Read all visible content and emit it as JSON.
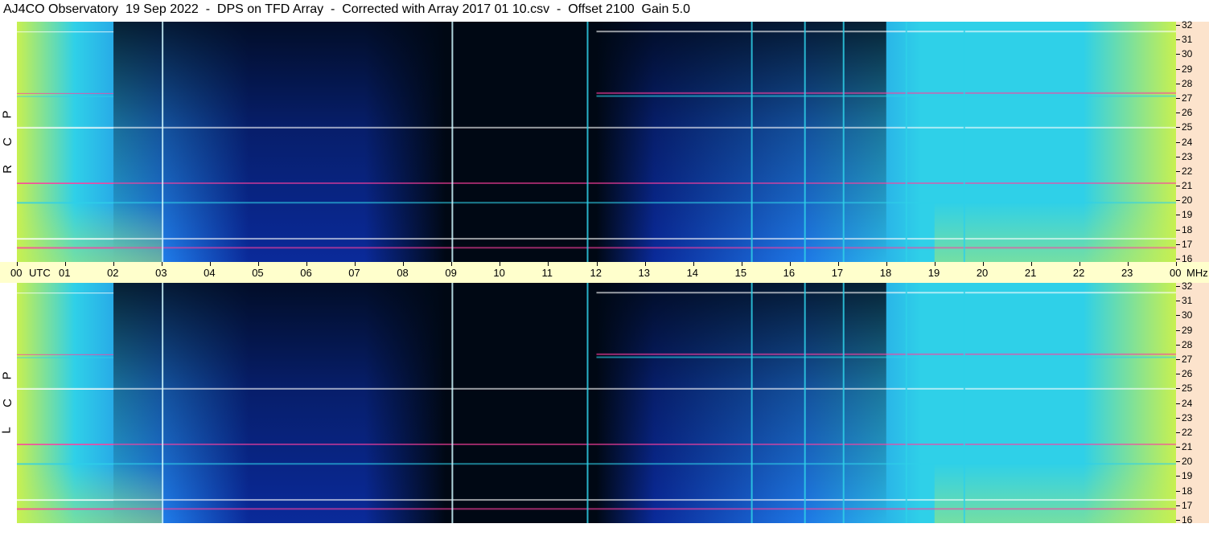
{
  "title": "AJ4CO Observatory  19 Sep 2022  -  DPS on TFD Array  -  Corrected with Array 2017 01 10.csv  -  Offset 2100  Gain 5.0",
  "panels": [
    {
      "polarization": [
        "R",
        "C",
        "P"
      ]
    },
    {
      "polarization": [
        "L",
        "C",
        "P"
      ]
    }
  ],
  "time_axis": {
    "labels": [
      "00",
      "UTC",
      "01",
      "02",
      "03",
      "04",
      "05",
      "06",
      "07",
      "08",
      "09",
      "10",
      "11",
      "12",
      "13",
      "14",
      "15",
      "16",
      "17",
      "18",
      "19",
      "20",
      "21",
      "22",
      "23",
      "00",
      "MHz"
    ]
  },
  "freq_axis": {
    "labels": [
      "32",
      "31",
      "30",
      "29",
      "28",
      "27",
      "26",
      "25",
      "24",
      "23",
      "22",
      "21",
      "20",
      "19",
      "18",
      "17",
      "16"
    ]
  },
  "colors": {
    "quiet": "#000814",
    "low": "#0a2a9a",
    "mid": "#1e78e6",
    "high": "#2fd0e8",
    "peak": "#c8f050",
    "burst": "#ff40a0"
  },
  "chart_data": {
    "type": "heatmap",
    "title": "AJ4CO Observatory  19 Sep 2022  -  DPS on TFD Array  -  Corrected with Array 2017 01 10.csv  -  Offset 2100  Gain 5.0",
    "x_unit": "UTC",
    "y_unit": "MHz",
    "xlim": [
      0,
      24
    ],
    "ylim": [
      16,
      32
    ],
    "x_ticks": [
      "00",
      "01",
      "02",
      "03",
      "04",
      "05",
      "06",
      "07",
      "08",
      "09",
      "10",
      "11",
      "12",
      "13",
      "14",
      "15",
      "16",
      "17",
      "18",
      "19",
      "20",
      "21",
      "22",
      "23",
      "00"
    ],
    "y_ticks": [
      32,
      31,
      30,
      29,
      28,
      27,
      26,
      25,
      24,
      23,
      22,
      21,
      20,
      19,
      18,
      17,
      16
    ],
    "panels": [
      "RCP",
      "LCP"
    ],
    "vertical_lines_utc": [
      3.0,
      9.0,
      11.8,
      15.2,
      16.3,
      17.1,
      18.4,
      19.6
    ],
    "interference_bands_mhz": [
      17.0,
      17.6,
      20.0,
      21.3,
      25.0,
      27.1,
      27.3,
      31.4
    ]
  }
}
